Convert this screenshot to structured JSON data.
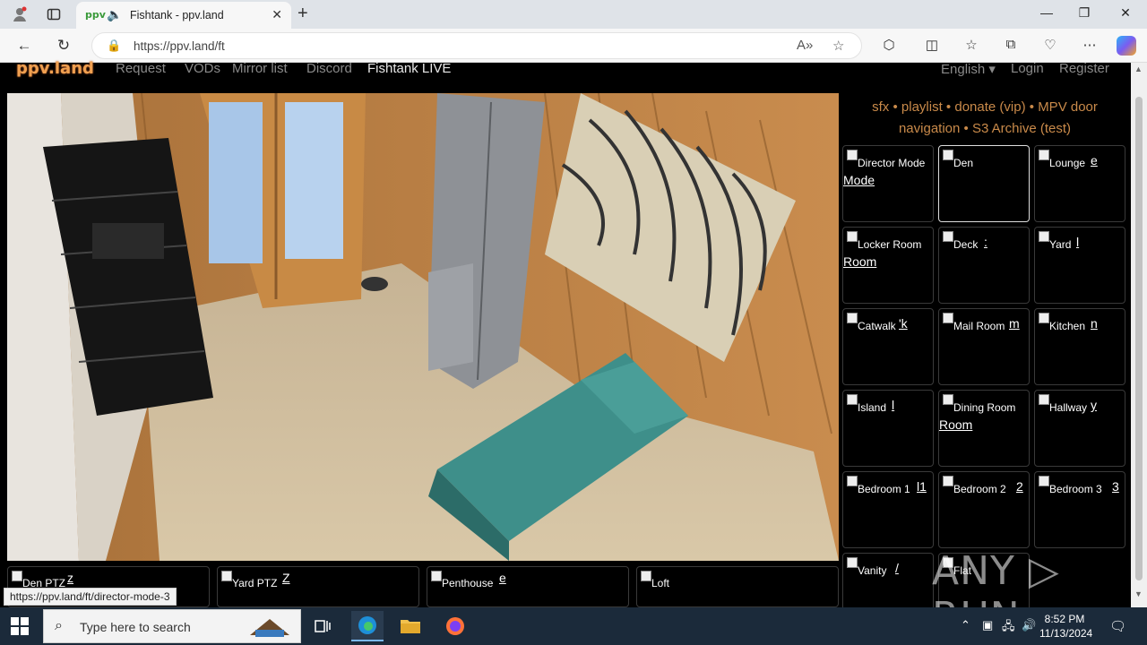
{
  "browser": {
    "tab_title": "Fishtank - ppv.land",
    "url": "https://ppv.land/ft",
    "favicon_text": "ppv"
  },
  "site": {
    "logo": "ppv.land",
    "nav": [
      "Request",
      "VODs",
      "Mirror list",
      "Discord",
      "Fishtank LIVE"
    ],
    "nav_right": {
      "language": "English ▾",
      "login": "Login",
      "register": "Register"
    }
  },
  "panel": {
    "links_line1": [
      "sfx",
      "playlist",
      "donate (vip)",
      "MPV door"
    ],
    "links_line2": [
      "navigation",
      "S3 Archive (test)"
    ],
    "separator": "•",
    "cameras": [
      {
        "label": "Director Mode",
        "label2": "Mode",
        "ghost": ""
      },
      {
        "label": "Den",
        "label2": "",
        "ghost": ""
      },
      {
        "label": "Lounge",
        "label2": "",
        "ghost": "e"
      },
      {
        "label": "Locker Room",
        "label2": "Room",
        "ghost": ""
      },
      {
        "label": "Deck",
        "label2": "",
        "ghost": ":"
      },
      {
        "label": "Yard",
        "label2": "",
        "ghost": "l"
      },
      {
        "label": "Catwalk",
        "label2": "",
        "ghost": "'k"
      },
      {
        "label": "Mail Room",
        "label2": "",
        "ghost": "m"
      },
      {
        "label": "Kitchen",
        "label2": "",
        "ghost": "n"
      },
      {
        "label": "Island",
        "label2": "",
        "ghost": "l"
      },
      {
        "label": "Dining Room",
        "label2": "Room",
        "ghost": ""
      },
      {
        "label": "Hallway",
        "label2": "",
        "ghost": "y"
      },
      {
        "label": "Bedroom 1",
        "label2": "",
        "ghost": "l1"
      },
      {
        "label": "Bedroom 2",
        "label2": "",
        "ghost": "2"
      },
      {
        "label": "Bedroom 3",
        "label2": "",
        "ghost": "3"
      },
      {
        "label": "Vanity",
        "label2": "",
        "ghost": "/"
      },
      {
        "label": "Flat",
        "label2": "",
        "ghost": ""
      }
    ]
  },
  "bottom_cams": [
    {
      "label": "Den PTZ",
      "ghost": "z"
    },
    {
      "label": "Yard PTZ",
      "ghost": "Z"
    },
    {
      "label": "Penthouse",
      "ghost": "e"
    },
    {
      "label": "Loft",
      "ghost": ""
    }
  ],
  "status_link": "https://ppv.land/ft/director-mode-3",
  "watermark": "ANY ▷ RUN",
  "taskbar": {
    "search_placeholder": "Type here to search",
    "time": "8:52 PM",
    "date": "11/13/2024"
  },
  "colors": {
    "accent_link": "#c98a4a",
    "logo": "#f0a050",
    "taskbar": "#1b2a3a"
  }
}
